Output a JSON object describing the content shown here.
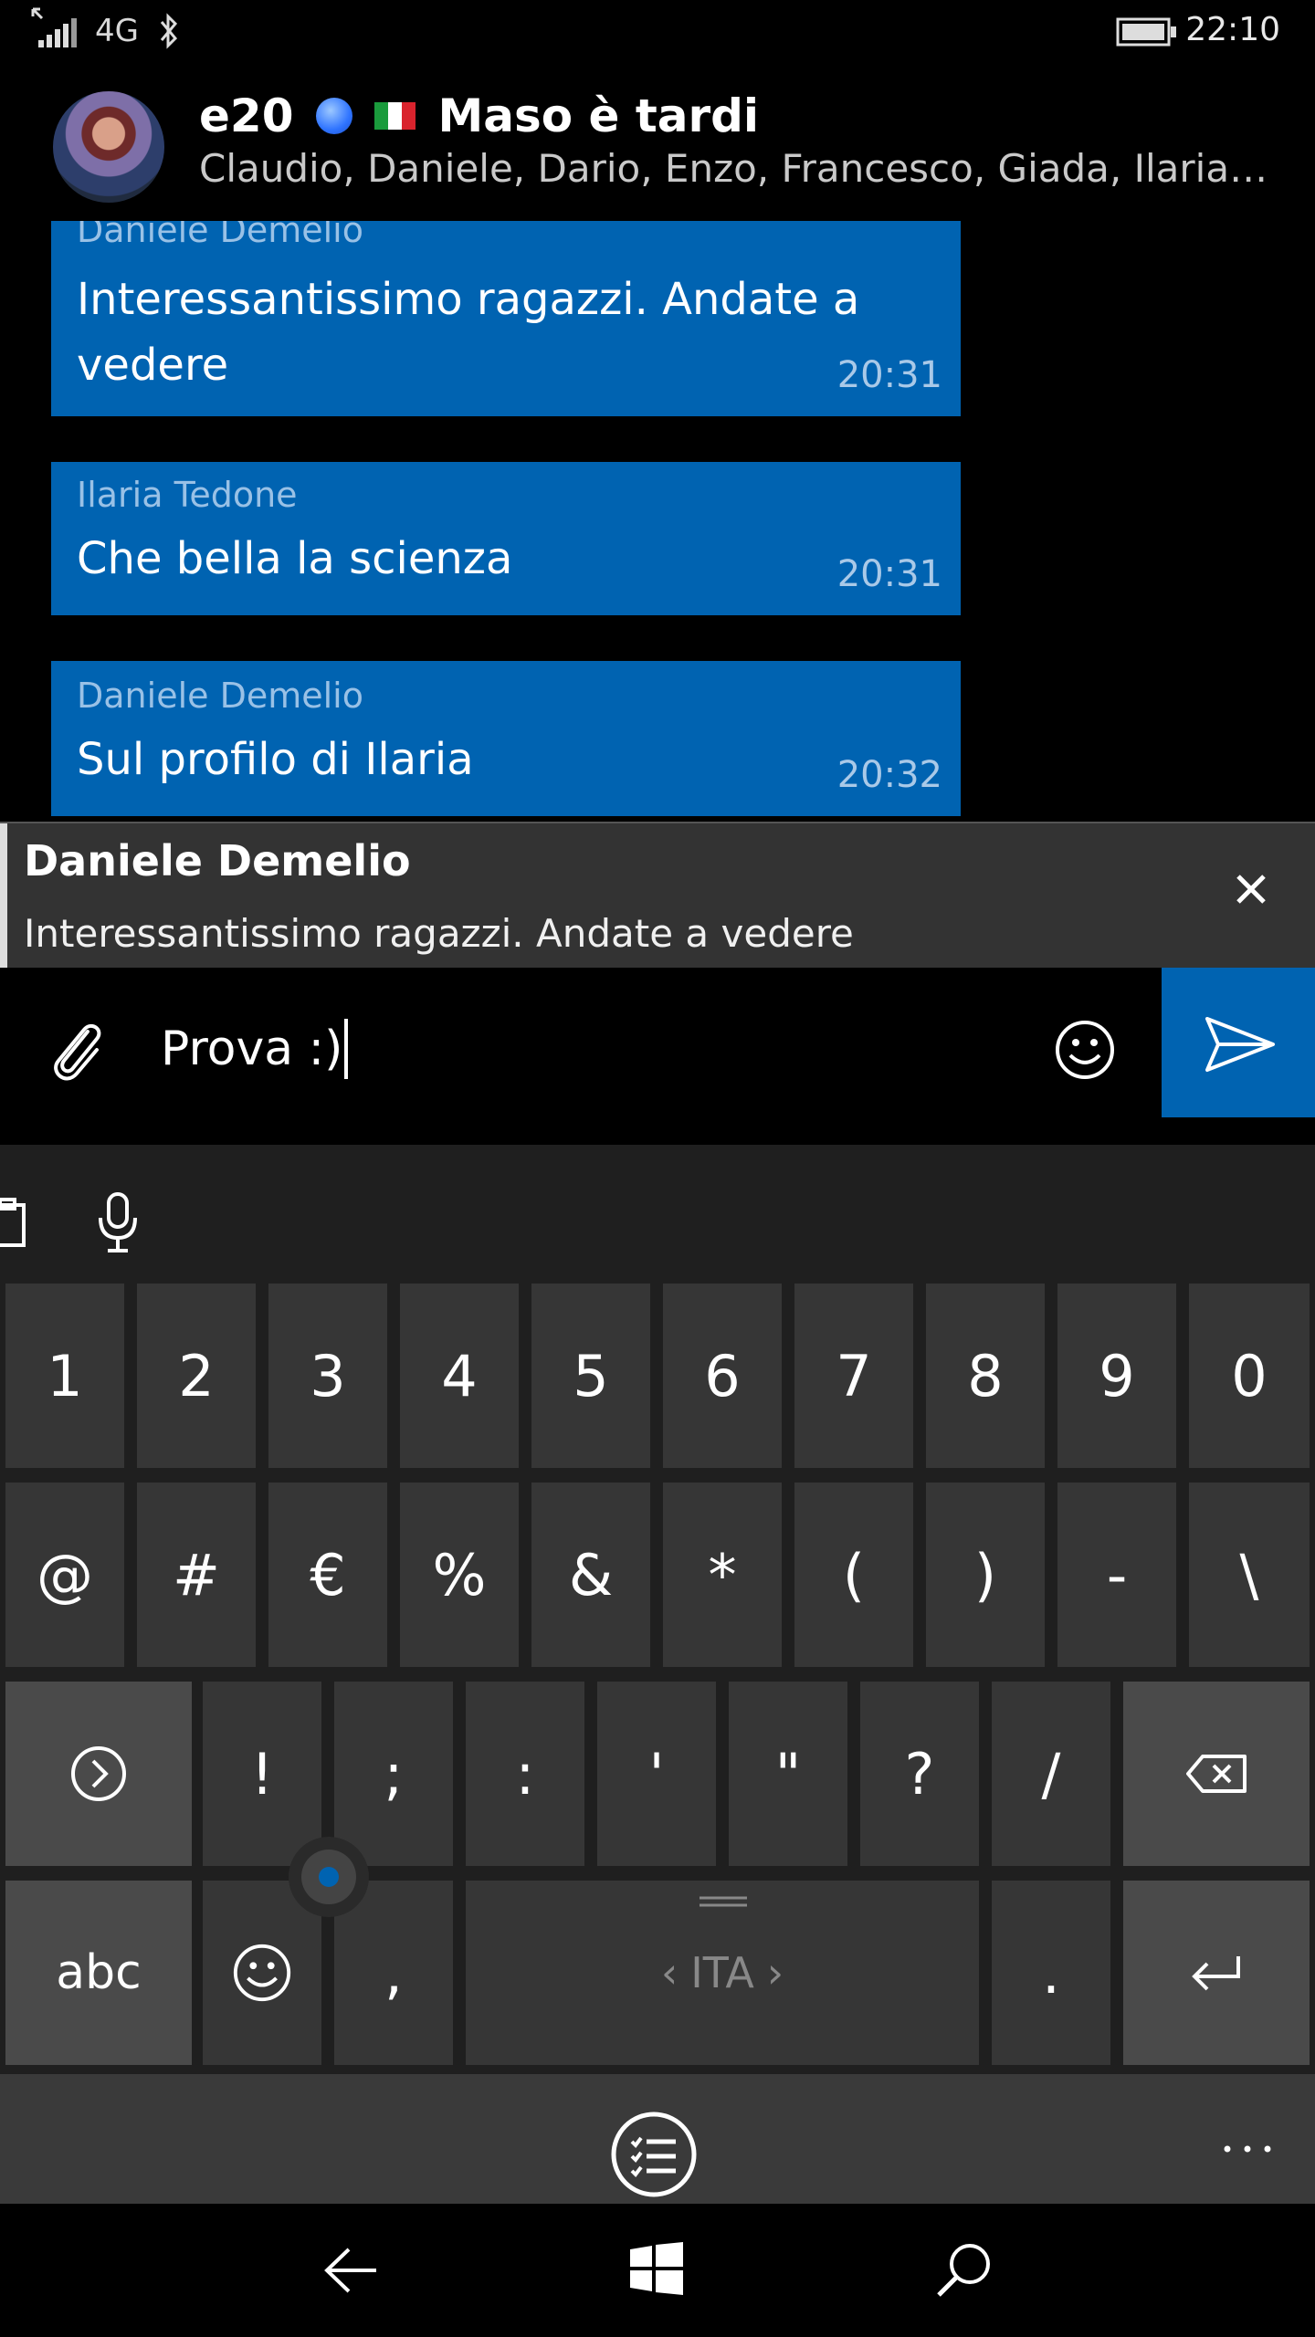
{
  "status_bar": {
    "network": "4G",
    "time": "22:10"
  },
  "header": {
    "chat_name": "e20",
    "chat_title": "Maso è tardi",
    "members": "Claudio, Daniele, Dario, Enzo, Francesco, Giada, Ilaria, ..."
  },
  "messages": [
    {
      "sender": "Daniele Demelio",
      "text": "Interessantissimo ragazzi. Andate a vedere",
      "time": "20:31"
    },
    {
      "sender": "Ilaria Tedone",
      "text": "Che bella la scienza",
      "time": "20:31"
    },
    {
      "sender": "Daniele Demelio",
      "text": "Sul profilo di Ilaria",
      "time": "20:32"
    }
  ],
  "reply": {
    "name": "Daniele Demelio",
    "text": "Interessantissimo ragazzi. Andate a vedere"
  },
  "input": {
    "value": "Prova :)"
  },
  "keyboard": {
    "row1": [
      "1",
      "2",
      "3",
      "4",
      "5",
      "6",
      "7",
      "8",
      "9",
      "0"
    ],
    "row2": [
      "@",
      "#",
      "€",
      "%",
      "&",
      "*",
      "(",
      ")",
      "-",
      "\\"
    ],
    "row3": [
      "!",
      ";",
      ":",
      "'",
      "\"",
      "?",
      "/"
    ],
    "abc_label": "abc",
    "comma_label": ",",
    "space_label": "ITA",
    "period_label": "."
  },
  "colors": {
    "accent": "#0063b1",
    "key": "#363636",
    "key_dark": "#4a4a4a",
    "keyboard_bg": "#1f1f1f"
  },
  "icons": [
    "signal-icon",
    "bluetooth-icon",
    "battery-icon",
    "attach-icon",
    "emoji-icon",
    "send-icon",
    "clipboard-icon",
    "microphone-icon",
    "symbols-toggle-icon",
    "backspace-icon",
    "emoji-key-icon",
    "enter-icon",
    "menu-list-icon",
    "more-icon",
    "back-icon",
    "windows-icon",
    "search-icon"
  ]
}
